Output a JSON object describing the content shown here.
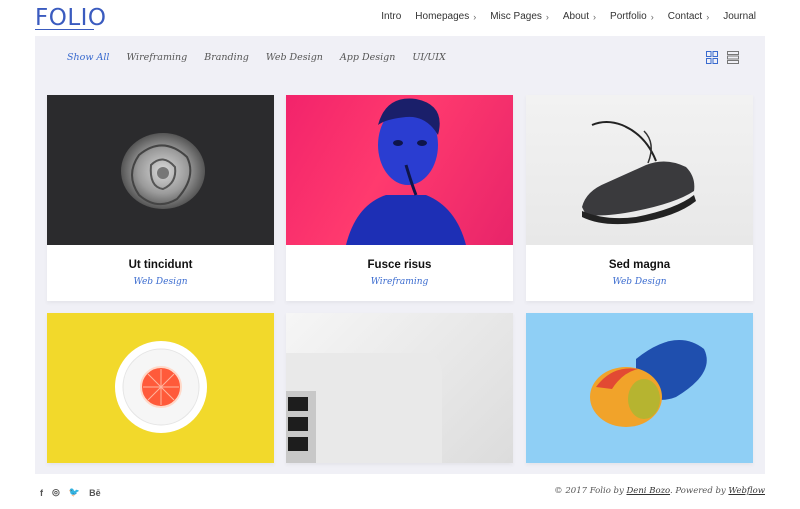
{
  "header": {
    "logo": "FOLIO",
    "nav": [
      {
        "label": "Intro",
        "has_menu": false
      },
      {
        "label": "Homepages",
        "has_menu": true
      },
      {
        "label": "Misc Pages",
        "has_menu": true
      },
      {
        "label": "About",
        "has_menu": true
      },
      {
        "label": "Portfolio",
        "has_menu": true
      },
      {
        "label": "Contact",
        "has_menu": true
      },
      {
        "label": "Journal",
        "has_menu": false
      }
    ]
  },
  "filters": [
    "Show All",
    "Wireframing",
    "Branding",
    "Web Design",
    "App Design",
    "UI/UIX"
  ],
  "active_filter": "Show All",
  "view_toggle": {
    "grid_icon": "grid-view-icon",
    "list_icon": "list-view-icon"
  },
  "cards": [
    {
      "title": "Ut tincidunt",
      "category": "Web Design",
      "image": "rose-photo"
    },
    {
      "title": "Fusce risus",
      "category": "Wireframing",
      "image": "man-neon-photo"
    },
    {
      "title": "Sed magna",
      "category": "Web Design",
      "image": "sneaker-photo"
    },
    {
      "title": "",
      "category": "",
      "image": "grapefruit-plate-photo"
    },
    {
      "title": "",
      "category": "",
      "image": "laptop-photo"
    },
    {
      "title": "",
      "category": "",
      "image": "mango-photo"
    }
  ],
  "footer": {
    "social": [
      "f",
      "◎",
      "🐦",
      "Bē"
    ],
    "copyright_prefix": "© 2017 Folio by ",
    "author": "Deni Bozo",
    "powered_prefix": ". Powered by ",
    "powered": "Webflow"
  },
  "colors": {
    "accent": "#3a6bcf",
    "panel_bg": "#f0f0f6"
  }
}
